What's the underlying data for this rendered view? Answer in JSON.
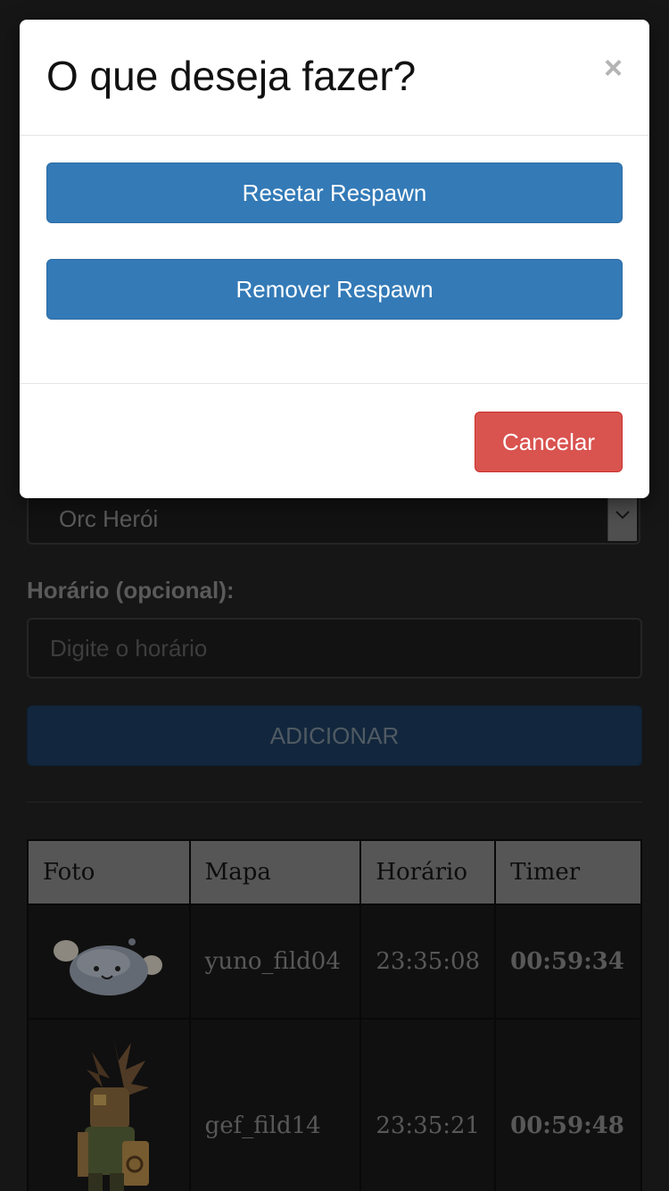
{
  "modal": {
    "title": "O que deseja fazer?",
    "close_glyph": "×",
    "reset_label": "Resetar Respawn",
    "remove_label": "Remover Respawn",
    "cancel_label": "Cancelar"
  },
  "form": {
    "monster_select_value": "Orc Herói",
    "time_label": "Horário (opcional):",
    "time_placeholder": "Digite o horário",
    "add_label": "ADICIONAR"
  },
  "table": {
    "headers": [
      "Foto",
      "Mapa",
      "Horário",
      "Timer"
    ],
    "rows": [
      {
        "map": "yuno_fild04",
        "time": "23:35:08",
        "timer": "00:59:34"
      },
      {
        "map": "gef_fild14",
        "time": "23:35:21",
        "timer": "00:59:48"
      }
    ]
  },
  "colors": {
    "primary": "#337ab7",
    "danger": "#d9534f",
    "timer_green": "#0f6e0f"
  },
  "icons": {
    "close": "close-icon",
    "select_arrow": "chevron-down-icon"
  }
}
